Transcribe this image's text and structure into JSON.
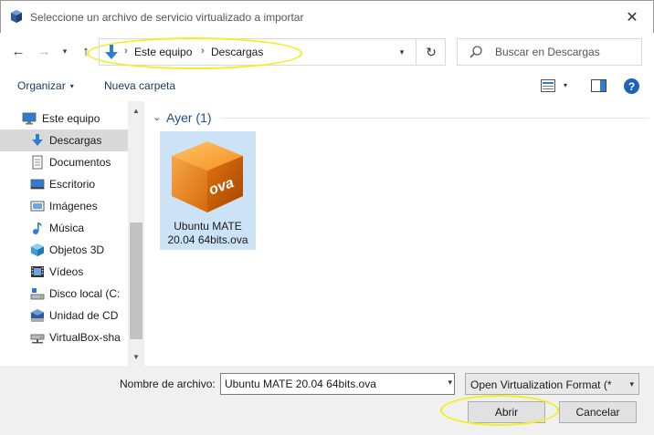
{
  "window": {
    "title": "Seleccione un archivo de servicio virtualizado a importar",
    "close_glyph": "✕"
  },
  "navigation": {
    "back_glyph": "←",
    "forward_glyph": "→",
    "recent_glyph": "▾",
    "up_glyph": "↑",
    "breadcrumb": [
      "Este equipo",
      "Descargas"
    ],
    "separator": "›",
    "dropdown_glyph": "▾",
    "refresh_glyph": "↻"
  },
  "search": {
    "placeholder": "Buscar en Descargas"
  },
  "toolbar": {
    "organize_label": "Organizar",
    "organize_caret": "▾",
    "new_folder_label": "Nueva carpeta",
    "view_caret": "▾",
    "help_label": "?"
  },
  "sidebar": {
    "items": [
      {
        "label": "Este equipo",
        "icon": "computer-icon",
        "selected": false
      },
      {
        "label": "Descargas",
        "icon": "download-folder-icon",
        "selected": true
      },
      {
        "label": "Documentos",
        "icon": "documents-icon",
        "selected": false
      },
      {
        "label": "Escritorio",
        "icon": "desktop-icon",
        "selected": false
      },
      {
        "label": "Imágenes",
        "icon": "pictures-icon",
        "selected": false
      },
      {
        "label": "Música",
        "icon": "music-icon",
        "selected": false
      },
      {
        "label": "Objetos 3D",
        "icon": "3d-objects-icon",
        "selected": false
      },
      {
        "label": "Vídeos",
        "icon": "videos-icon",
        "selected": false
      },
      {
        "label": "Disco local (C:",
        "icon": "local-disk-icon",
        "selected": false
      },
      {
        "label": "Unidad de CD",
        "icon": "cd-drive-icon",
        "selected": false
      },
      {
        "label": "VirtualBox-sha",
        "icon": "network-drive-icon",
        "selected": false
      }
    ],
    "scroll_up_glyph": "▲",
    "scroll_down_glyph": "▼"
  },
  "content": {
    "group": {
      "label": "Ayer (1)",
      "chevron": "⌄"
    },
    "files": [
      {
        "name": "Ubuntu MATE 20.04 64bits.ova",
        "icon": "ova-file-icon",
        "icon_text": "ova",
        "selected": true
      }
    ]
  },
  "footer": {
    "filename_label": "Nombre de archivo:",
    "filename_value": "Ubuntu MATE 20.04 64bits.ova",
    "filetype_value": "Open Virtualization Format (*",
    "open_label": "Abrir",
    "cancel_label": "Cancelar",
    "dropdown_glyph": "▾"
  },
  "colors": {
    "accent": "#1e63b8",
    "selection": "#cce3f7",
    "highlight_annotation": "#f5ee1e"
  }
}
